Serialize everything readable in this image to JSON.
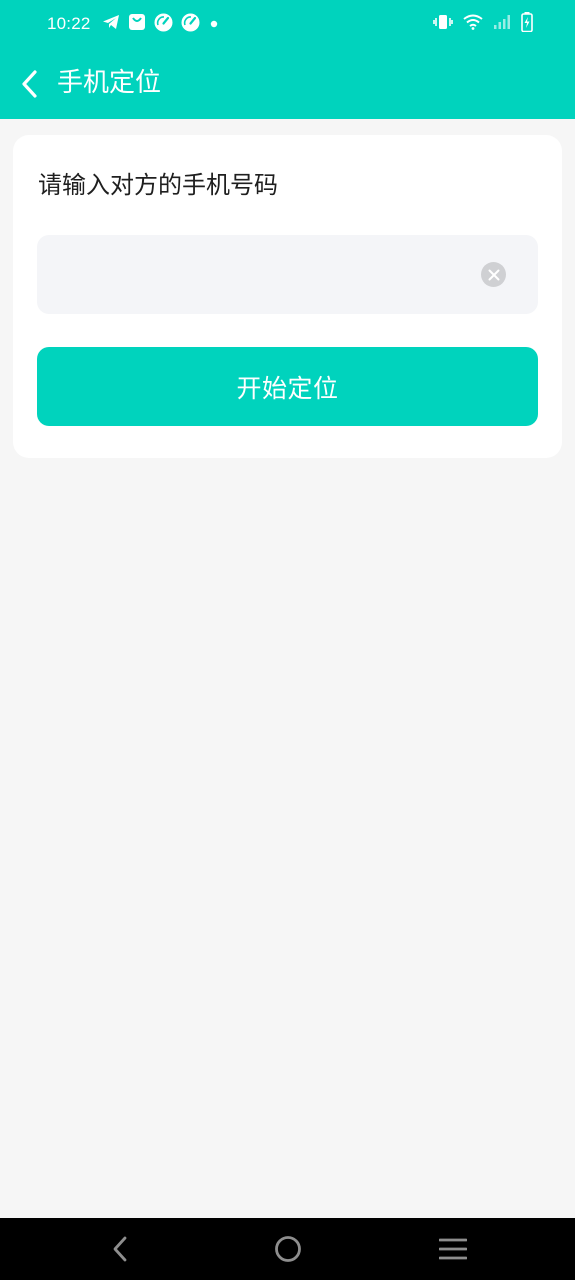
{
  "status_bar": {
    "time": "10:22",
    "left_icons": [
      "telegram-icon",
      "shopping-bag-icon",
      "speedometer-icon",
      "speedometer-icon",
      "notification-dot-icon"
    ],
    "right_icons": [
      "vibrate-icon",
      "wifi-icon",
      "signal-icon",
      "battery-charging-icon"
    ]
  },
  "app_bar": {
    "title": "手机定位",
    "back_icon": "chevron-left-icon"
  },
  "form": {
    "prompt": "请输入对方的手机号码",
    "phone_value": "",
    "phone_placeholder": "",
    "clear_icon": "clear-circle-icon",
    "submit_label": "开始定位"
  },
  "nav_bar": {
    "icons": [
      "nav-back-icon",
      "nav-home-icon",
      "nav-menu-icon"
    ]
  },
  "colors": {
    "accent": "#00d3bd",
    "page_background": "#f6f6f6",
    "card_background": "#ffffff",
    "input_background": "#f4f5f8",
    "title_text": "#1f1f1f"
  }
}
